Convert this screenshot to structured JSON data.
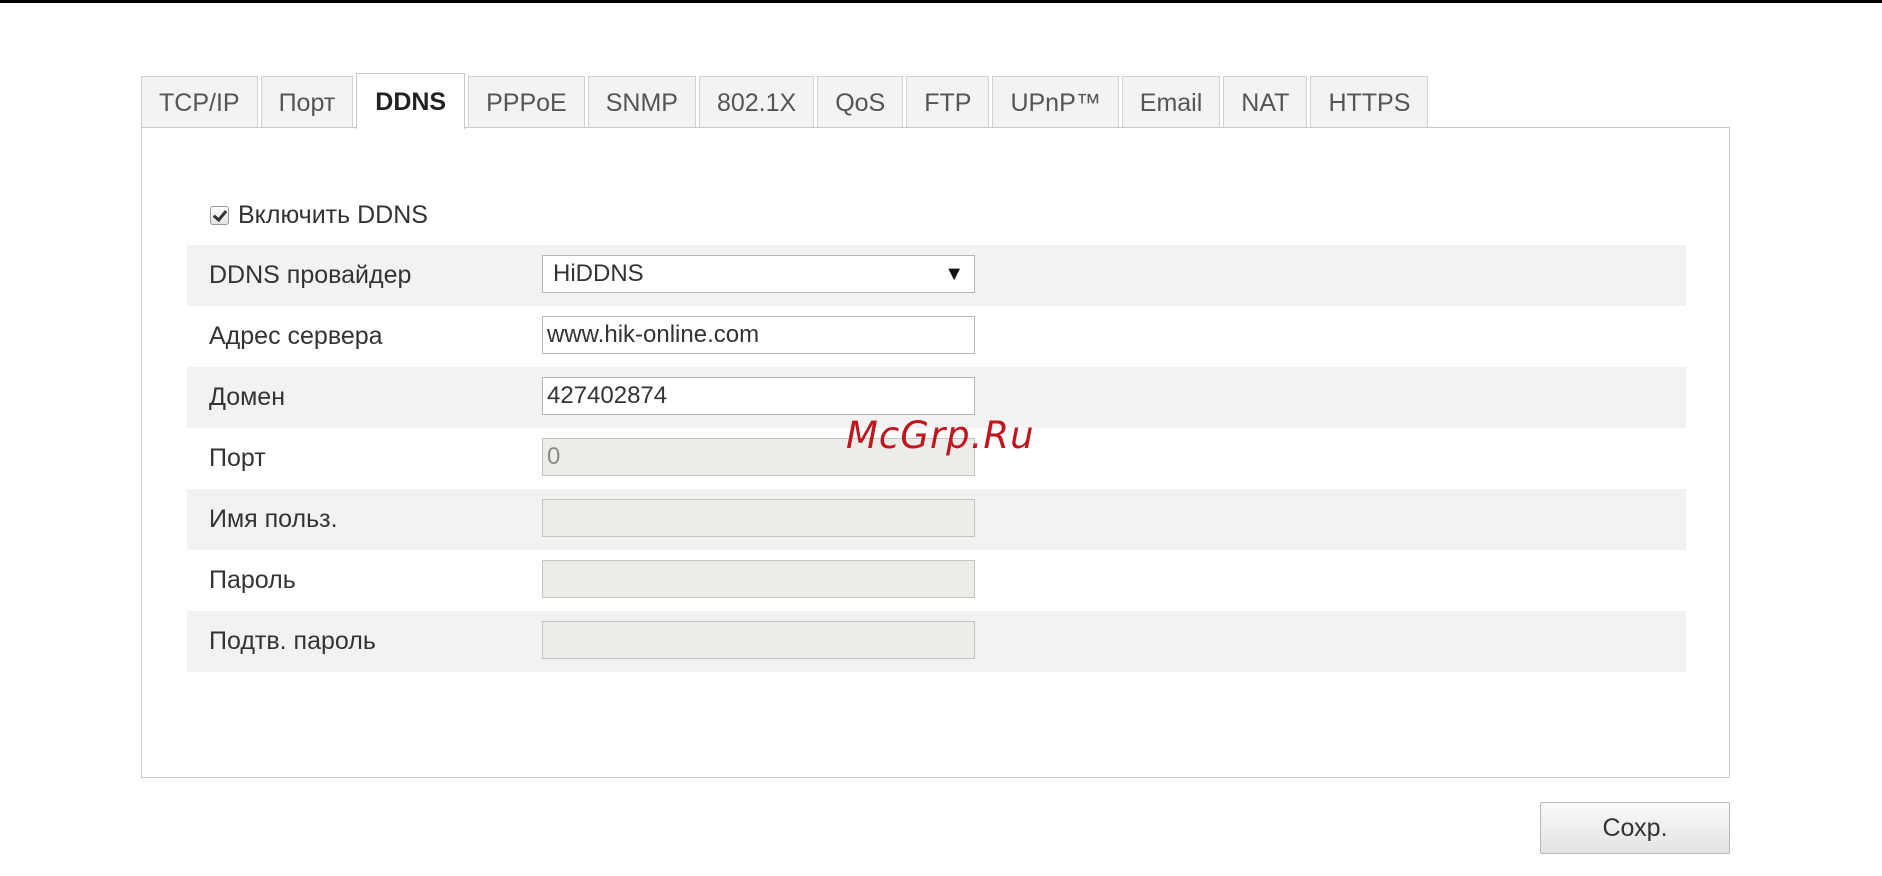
{
  "tabs": [
    {
      "label": "TCP/IP",
      "active": false
    },
    {
      "label": "Порт",
      "active": false
    },
    {
      "label": "DDNS",
      "active": true
    },
    {
      "label": "PPPoE",
      "active": false
    },
    {
      "label": "SNMP",
      "active": false
    },
    {
      "label": "802.1X",
      "active": false
    },
    {
      "label": "QoS",
      "active": false
    },
    {
      "label": "FTP",
      "active": false
    },
    {
      "label": "UPnP™",
      "active": false
    },
    {
      "label": "Email",
      "active": false
    },
    {
      "label": "NAT",
      "active": false
    },
    {
      "label": "HTTPS",
      "active": false
    }
  ],
  "enable_ddns": {
    "label": "Включить DDNS",
    "checked": true
  },
  "form": {
    "provider": {
      "label": "DDNS провайдер",
      "value": "HiDDNS",
      "arrow": "▼"
    },
    "server_address": {
      "label": "Адрес сервера",
      "value": "www.hik-online.com"
    },
    "domain": {
      "label": "Домен",
      "value": "427402874"
    },
    "port": {
      "label": "Порт",
      "value": "0"
    },
    "username": {
      "label": "Имя польз.",
      "value": ""
    },
    "password": {
      "label": "Пароль",
      "value": ""
    },
    "confirm_password": {
      "label": "Подтв. пароль",
      "value": ""
    }
  },
  "save_button": {
    "label": "Сохр."
  },
  "watermark": {
    "text": "McGrp.Ru"
  },
  "colors": {
    "watermark": "#c0161e",
    "disabled_field": "#ecece8",
    "row_shade": "#f2f2f2"
  }
}
